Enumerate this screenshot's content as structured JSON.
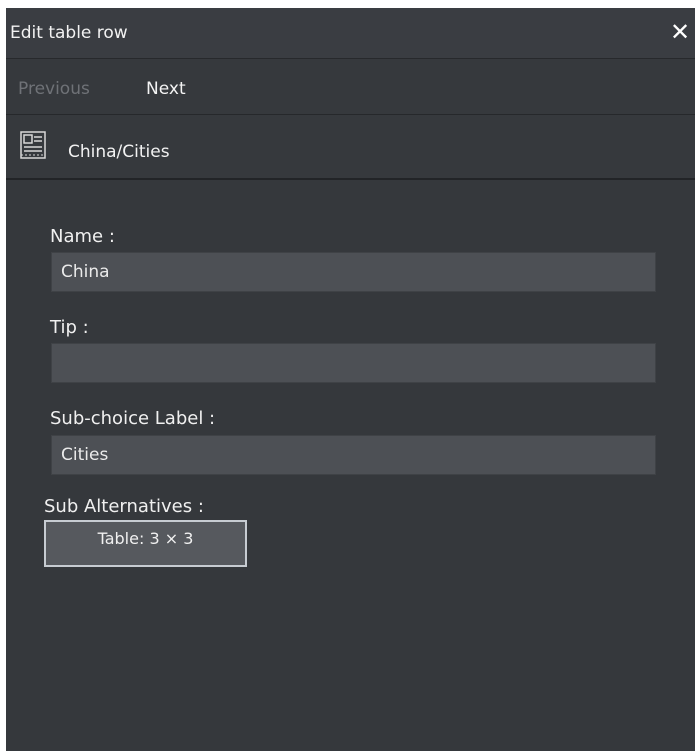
{
  "dialog": {
    "title": "Edit table row",
    "close_symbol": "✕"
  },
  "nav": {
    "previous_label": "Previous",
    "next_label": "Next"
  },
  "path": {
    "icon": "table-icon",
    "text": "China/Cities"
  },
  "form": {
    "name": {
      "label": "Name :",
      "value": "China"
    },
    "tip": {
      "label": "Tip :",
      "value": ""
    },
    "sub_choice_label": {
      "label": "Sub-choice Label :",
      "value": "Cities"
    },
    "sub_alternatives": {
      "label": "Sub Alternatives :",
      "button_label": "Table: 3 × 3"
    }
  },
  "colors": {
    "panel_background": "#35383c",
    "input_background": "#4d5055",
    "button_border": "#c7ccd2",
    "disabled_text": "#6f7277"
  }
}
